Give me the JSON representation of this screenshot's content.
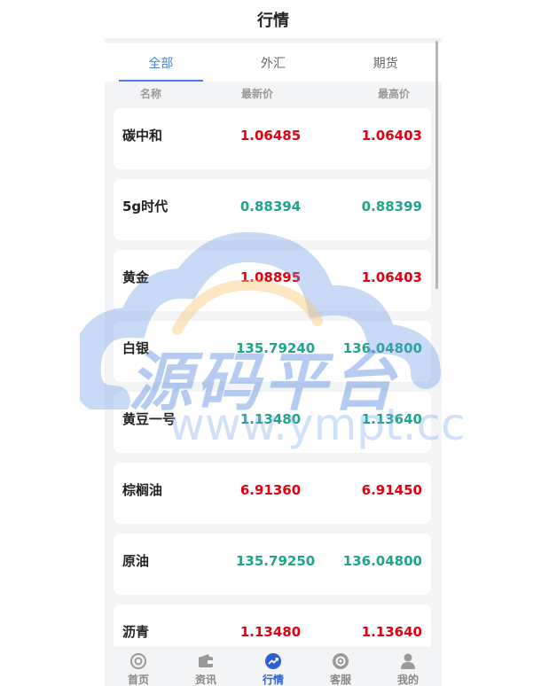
{
  "header": {
    "title": "行情"
  },
  "tabs": [
    {
      "label": "全部",
      "active": true
    },
    {
      "label": "外汇",
      "active": false
    },
    {
      "label": "期货",
      "active": false
    }
  ],
  "columns": {
    "name": "名称",
    "latest": "最新价",
    "high": "最高价"
  },
  "rows": [
    {
      "name": "碳中和",
      "latest": "1.06485",
      "high": "1.06403",
      "color": "red"
    },
    {
      "name": "5g时代",
      "latest": "0.88394",
      "high": "0.88399",
      "color": "green"
    },
    {
      "name": "黄金",
      "latest": "1.08895",
      "high": "1.06403",
      "color": "red"
    },
    {
      "name": "白银",
      "latest": "135.79240",
      "high": "136.04800",
      "color": "green"
    },
    {
      "name": "黄豆一号",
      "latest": "1.13480",
      "high": "1.13640",
      "color": "green"
    },
    {
      "name": "棕榈油",
      "latest": "6.91360",
      "high": "6.91450",
      "color": "red"
    },
    {
      "name": "原油",
      "latest": "135.79250",
      "high": "136.04800",
      "color": "green"
    },
    {
      "name": "沥青",
      "latest": "1.13480",
      "high": "1.13640",
      "color": "red"
    }
  ],
  "watermark": {
    "text": "源码平台",
    "url": "www.ympt.cc"
  },
  "tabbar": [
    {
      "label": "首页",
      "icon": "home-icon",
      "active": false
    },
    {
      "label": "资讯",
      "icon": "wallet-icon",
      "active": false
    },
    {
      "label": "行情",
      "icon": "trend-icon",
      "active": true
    },
    {
      "label": "客服",
      "icon": "service-icon",
      "active": false
    },
    {
      "label": "我的",
      "icon": "user-icon",
      "active": false
    }
  ],
  "colors": {
    "up": "#e4000f",
    "down": "#1fa58a",
    "accent": "#4a7ee8"
  }
}
